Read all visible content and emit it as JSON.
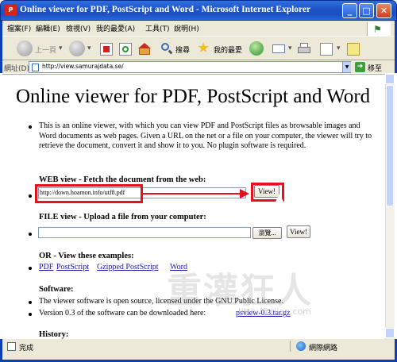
{
  "window": {
    "title": "Online viewer for PDF, PostScript and Word - Microsoft Internet Explorer",
    "icon": "pdf-icon"
  },
  "menu": [
    "檔案(F)",
    "編輯(E)",
    "檢視(V)",
    "我的最愛(A)",
    "工具(T)",
    "說明(H)"
  ],
  "toolbar": {
    "back": "上一頁",
    "search": "搜尋",
    "favorites": "我的最愛"
  },
  "address": {
    "label": "網址(D)",
    "url": "http://view.samurajdata.se/",
    "go": "移至"
  },
  "page": {
    "title": "Online viewer for PDF, PostScript and Word",
    "intro": "This is an online viewer, with which you can view PDF and PostScript files as browsable images and Word documents as web pages. Given a URL on the net or a file on your computer, the viewer will try to retrieve the document, convert it and show it to you. No plugin software is required.",
    "web_heading": "WEB view - Fetch the document from the web:",
    "web_url": "http://down.hoamon.info/utf8.pdf",
    "view_button": "View!",
    "file_heading": "FILE view - Upload a file from your computer:",
    "browse_button": "瀏覽...",
    "file_view_button": "View!",
    "examples_heading": "OR - View these examples:",
    "examples": [
      "PDF",
      "PostScript",
      "Gzipped PostScript",
      "Word"
    ],
    "software_heading": "Software:",
    "software_line1": "The viewer software is open source, licensed under the GNU Public License.",
    "software_line2_prefix": "Version 0.3 of the software can be downloaded here: ",
    "software_link": "psview-0.3.tar.gz",
    "history_heading": "History:"
  },
  "watermark": {
    "main": "重灌狂人",
    "sub": "http://briian.com"
  },
  "status": {
    "text": "完成",
    "zone": "網際網路"
  },
  "colors": {
    "title_bar": "#1f55c8",
    "highlight": "#e8101c",
    "link": "#1a1aa6"
  }
}
